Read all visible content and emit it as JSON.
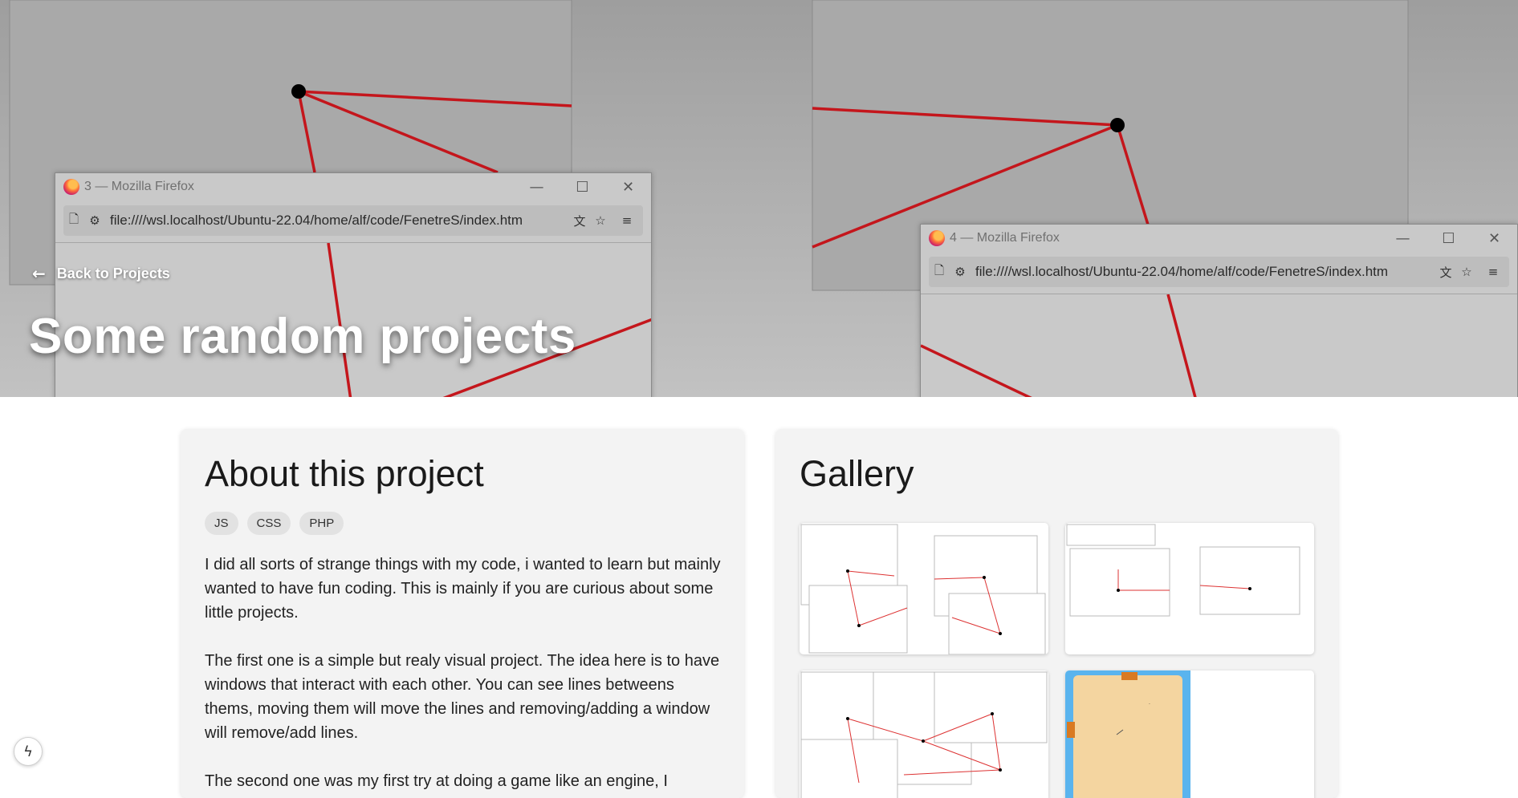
{
  "hero": {
    "back_label": "Back to Projects",
    "title": "Some random projects",
    "windows": [
      {
        "title": "3 — Mozilla Firefox",
        "url": "file:////wsl.localhost/Ubuntu-22.04/home/alf/code/FenetreS/index.htm"
      },
      {
        "title": "4 — Mozilla Firefox",
        "url": "file:////wsl.localhost/Ubuntu-22.04/home/alf/code/FenetreS/index.htm"
      }
    ]
  },
  "about": {
    "heading": "About this project",
    "tags": [
      "JS",
      "CSS",
      "PHP"
    ],
    "paragraphs": [
      "I did all sorts of strange things with my code, i wanted to learn but mainly wanted to have fun coding. This is mainly if you are curious about some little projects.",
      "The first one is a simple but realy visual project. The idea here is to have windows that interact with each other. You can see lines betweens thems, moving them will move the lines and removing/adding a window will remove/add lines.",
      "The second one was my first try at doing a game like an engine, I"
    ]
  },
  "gallery": {
    "heading": "Gallery",
    "images": [
      "Gallery screenshot 1",
      "Gallery screenshot 2",
      "Gallery screenshot 3",
      "Gallery screenshot 4"
    ]
  },
  "icons": {
    "back": "arrow-left-icon",
    "corner": "lightning-icon"
  }
}
